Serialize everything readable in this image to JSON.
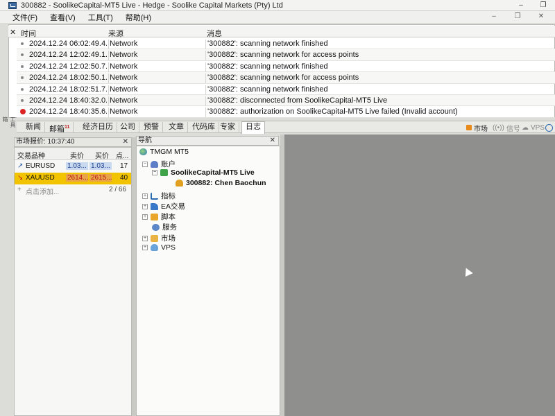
{
  "window": {
    "title": "300882 - SoolikeCapital-MT5 Live - Hedge - Soolike Capital Markets (Pty) Ltd",
    "app_icon": "mt5-icon"
  },
  "menu": {
    "items": [
      "文件(F)",
      "查看(V)",
      "工具(T)",
      "帮助(H)"
    ]
  },
  "journal": {
    "columns": {
      "time": "时间",
      "source": "来源",
      "message": "消息"
    },
    "rows": [
      {
        "time": "2024.12.24 06:02:49.4...",
        "source": "Network",
        "message": "'300882': scanning network finished",
        "level": "info"
      },
      {
        "time": "2024.12.24 12:02:49.1...",
        "source": "Network",
        "message": "'300882': scanning network for access points",
        "level": "info"
      },
      {
        "time": "2024.12.24 12:02:50.7...",
        "source": "Network",
        "message": "'300882': scanning network finished",
        "level": "info"
      },
      {
        "time": "2024.12.24 18:02:50.1...",
        "source": "Network",
        "message": "'300882': scanning network for access points",
        "level": "info"
      },
      {
        "time": "2024.12.24 18:02:51.7...",
        "source": "Network",
        "message": "'300882': scanning network finished",
        "level": "info"
      },
      {
        "time": "2024.12.24 18:40:32.0...",
        "source": "Network",
        "message": "'300882': disconnected from SoolikeCapital-MT5 Live",
        "level": "info"
      },
      {
        "time": "2024.12.24 18:40:35.6...",
        "source": "Network",
        "message": "'300882': authorization on SoolikeCapital-MT5 Live failed (Invalid account)",
        "level": "error"
      }
    ],
    "side_label": "工具箱"
  },
  "tabs": {
    "items": [
      {
        "label": "新闻"
      },
      {
        "label": "邮箱",
        "badge": "11"
      },
      {
        "label": "经济日历"
      },
      {
        "label": "公司"
      },
      {
        "label": "预警"
      },
      {
        "label": "文章"
      },
      {
        "label": "代码库"
      },
      {
        "label": "专家"
      },
      {
        "label": "日志"
      }
    ],
    "active": "日志",
    "status": {
      "market": "市场",
      "signals": "信号",
      "vps": "VPS"
    }
  },
  "market_watch": {
    "title": "市场报价: 10:37:40",
    "columns": {
      "symbol": "交易品种",
      "bid": "卖价",
      "ask": "买价",
      "spread": "点..."
    },
    "rows": [
      {
        "symbol": "EURUSD",
        "bid": "1.03...",
        "ask": "1.03...",
        "spread": "17",
        "direction": "up"
      },
      {
        "symbol": "XAUUSD",
        "bid": "2614...",
        "ask": "2615...",
        "spread": "40",
        "direction": "down"
      }
    ],
    "add_label": "点击添加...",
    "count": "2 / 66"
  },
  "navigator": {
    "title": "导航",
    "root": "TMGM MT5",
    "accounts_label": "账户",
    "server": "SoolikeCapital-MT5 Live",
    "account": "300882: Chen Baochun",
    "items": [
      "指标",
      "EA交易",
      "脚本",
      "服务",
      "市场",
      "VPS"
    ]
  }
}
